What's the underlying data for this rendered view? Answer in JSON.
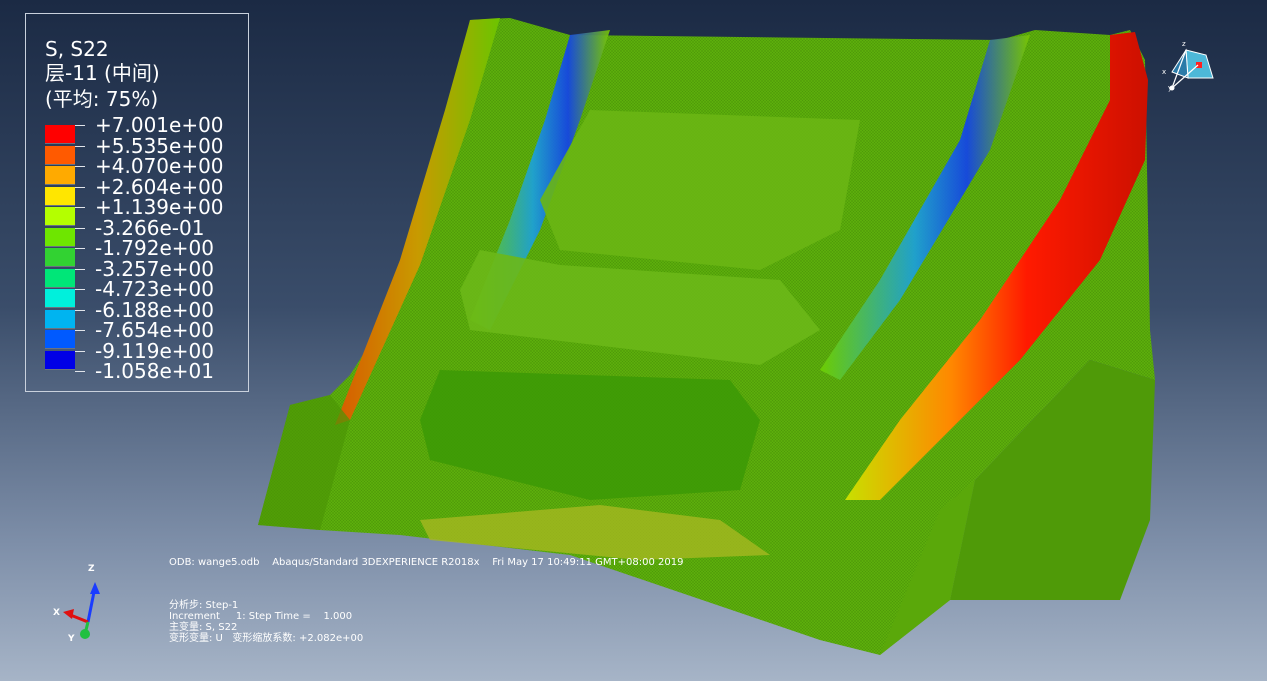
{
  "legend": {
    "title": "S, S22",
    "layer": "层-11 (中间)",
    "average": "(平均: 75%)",
    "levels": [
      "+7.001e+00",
      "+5.535e+00",
      "+4.070e+00",
      "+2.604e+00",
      "+1.139e+00",
      "-3.266e-01",
      "-1.792e+00",
      "-3.257e+00",
      "-4.723e+00",
      "-6.188e+00",
      "-7.654e+00",
      "-9.119e+00",
      "-1.058e+01"
    ],
    "colors": [
      "#ff0000",
      "#ff5a00",
      "#ffaa00",
      "#ffe600",
      "#b4ff00",
      "#6ee600",
      "#32d232",
      "#00e678",
      "#00f0dc",
      "#00b4f0",
      "#005aff",
      "#0000e6"
    ]
  },
  "info": {
    "odb": "ODB: wange5.odb    Abaqus/Standard 3DEXPERIENCE R2018x    Fri May 17 10:49:11 GMT+08:00 2019",
    "step": "分析步: Step-1",
    "increment": "Increment     1: Step Time =    1.000",
    "primary_var": "主变量: S, S22",
    "deformed_var": "变形变量: U   变形缩放系数: +2.082e+00"
  },
  "triad": {
    "x": "X",
    "y": "Y",
    "z": "Z"
  },
  "view_cube": {
    "x": "x",
    "y": "y",
    "z": "z"
  }
}
